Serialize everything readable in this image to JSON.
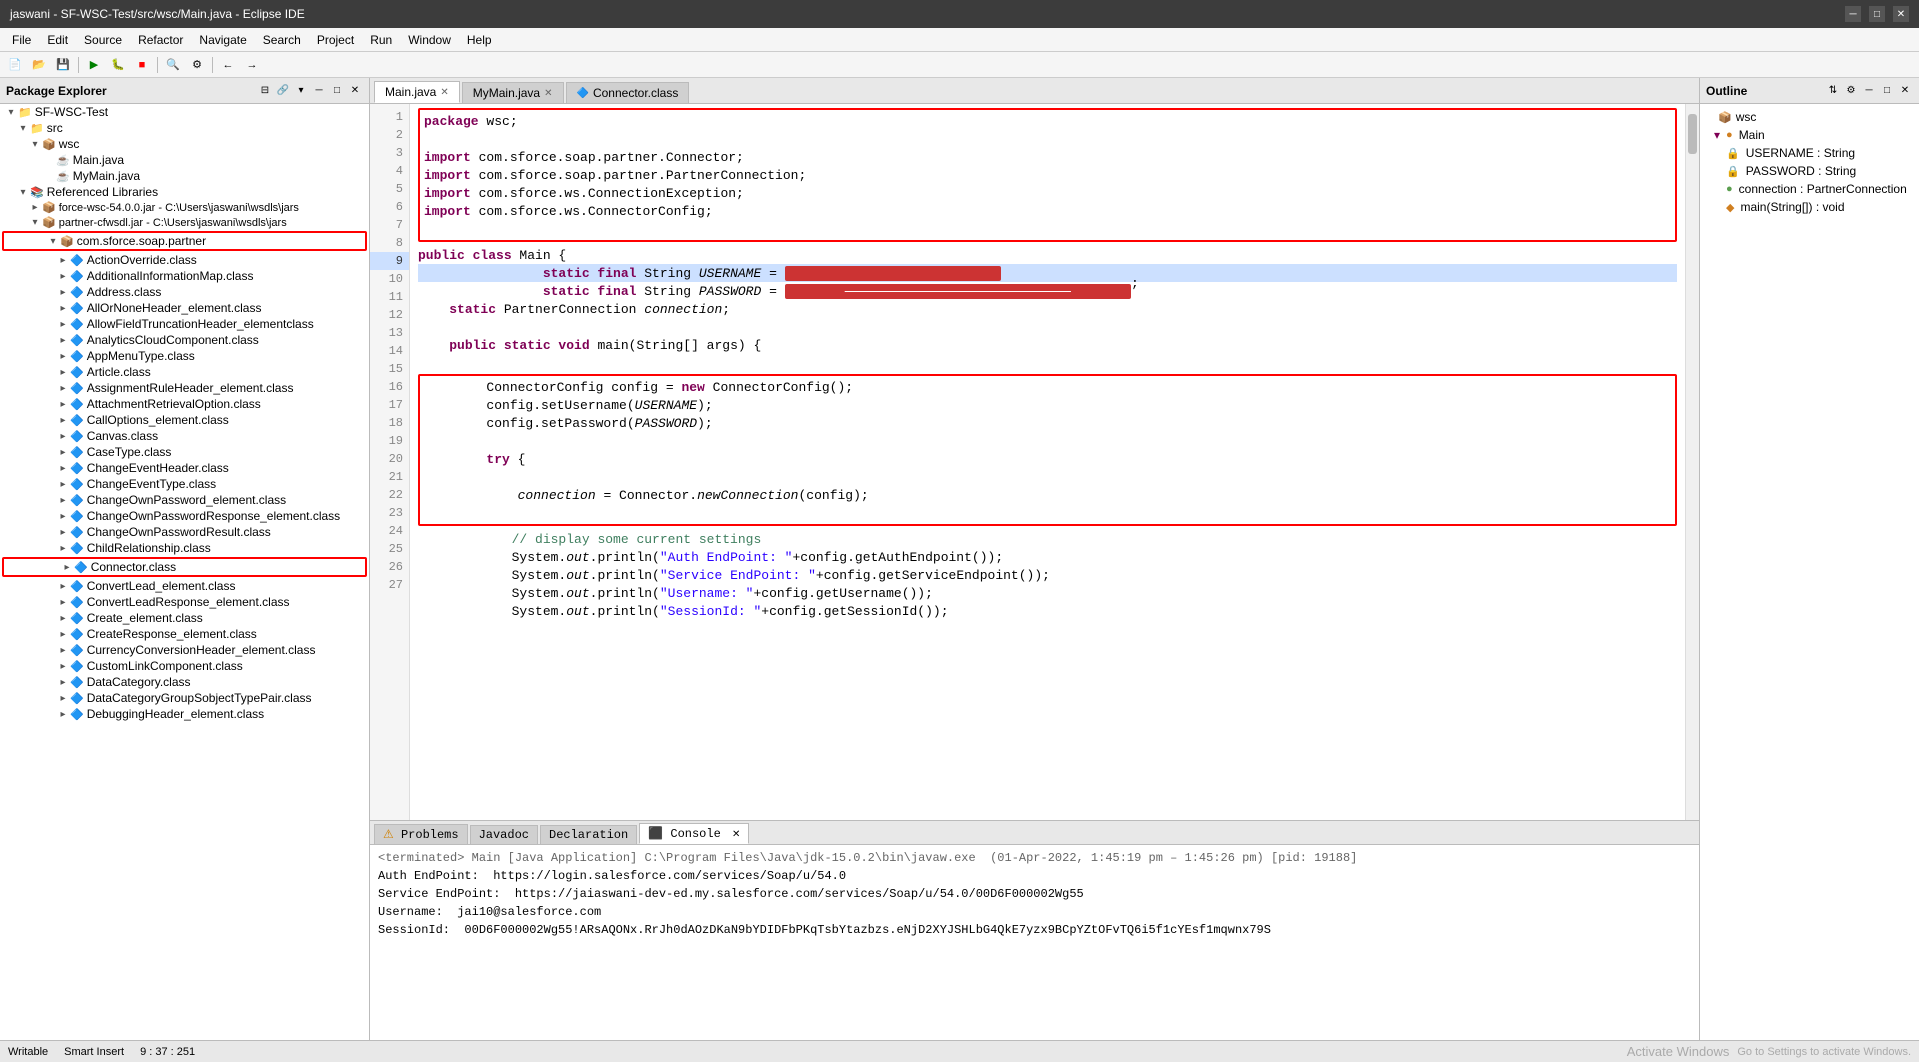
{
  "titleBar": {
    "title": "jaswani - SF-WSC-Test/src/wsc/Main.java - Eclipse IDE",
    "controls": [
      "─",
      "□",
      "✕"
    ]
  },
  "menuBar": {
    "items": [
      "File",
      "Edit",
      "Source",
      "Refactor",
      "Navigate",
      "Search",
      "Project",
      "Run",
      "Window",
      "Help"
    ]
  },
  "packageExplorer": {
    "title": "Package Explorer",
    "tree": [
      {
        "id": "sf-wsc-test",
        "label": "SF-WSC-Test",
        "level": 0,
        "type": "project",
        "expanded": true
      },
      {
        "id": "src",
        "label": "src",
        "level": 1,
        "type": "folder",
        "expanded": true
      },
      {
        "id": "wsc",
        "label": "wsc",
        "level": 2,
        "type": "package",
        "expanded": true
      },
      {
        "id": "main-java",
        "label": "Main.java",
        "level": 3,
        "type": "java"
      },
      {
        "id": "mymain-java",
        "label": "MyMain.java",
        "level": 3,
        "type": "java"
      },
      {
        "id": "ref-libs",
        "label": "Referenced Libraries",
        "level": 1,
        "type": "reflibs",
        "expanded": true
      },
      {
        "id": "force-wsc",
        "label": "force-wsc-54.0.0.jar - C:\\Users\\jaswani\\wsdls\\jars",
        "level": 2,
        "type": "jar"
      },
      {
        "id": "partner-cfwsdl",
        "label": "partner-cfwsdl.jar - C:\\Users\\jaswani\\wsdls\\jars",
        "level": 2,
        "type": "jar",
        "expanded": true
      },
      {
        "id": "com-sforce-soap-partner",
        "label": "com.sforce.soap.partner",
        "level": 3,
        "type": "package",
        "expanded": true,
        "boxed": true
      },
      {
        "id": "actionoverride",
        "label": "ActionOverride.class",
        "level": 4,
        "type": "class"
      },
      {
        "id": "additionalinfo",
        "label": "AdditionalInformationMap.class",
        "level": 4,
        "type": "class"
      },
      {
        "id": "address",
        "label": "Address.class",
        "level": 4,
        "type": "class"
      },
      {
        "id": "allornone",
        "label": "AllOrNoneHeader_element.class",
        "level": 4,
        "type": "class"
      },
      {
        "id": "allowfield",
        "label": "AllowFieldTruncationHeader_elementclass",
        "level": 4,
        "type": "class"
      },
      {
        "id": "analytics",
        "label": "AnalyticsCloudComponent.class",
        "level": 4,
        "type": "class"
      },
      {
        "id": "appmenu",
        "label": "AppMenuType.class",
        "level": 4,
        "type": "class"
      },
      {
        "id": "article",
        "label": "Article.class",
        "level": 4,
        "type": "class"
      },
      {
        "id": "assignmentrule",
        "label": "AssignmentRuleHeader_element.class",
        "level": 4,
        "type": "class"
      },
      {
        "id": "attachmentret",
        "label": "AttachmentRetrievalOption.class",
        "level": 4,
        "type": "class"
      },
      {
        "id": "calloptions",
        "label": "CallOptions_element.class",
        "level": 4,
        "type": "class"
      },
      {
        "id": "canvas",
        "label": "Canvas.class",
        "level": 4,
        "type": "class"
      },
      {
        "id": "casetype",
        "label": "CaseType.class",
        "level": 4,
        "type": "class"
      },
      {
        "id": "changeeventheader",
        "label": "ChangeEventHeader.class",
        "level": 4,
        "type": "class"
      },
      {
        "id": "changeeventtype",
        "label": "ChangeEventType.class",
        "level": 4,
        "type": "class"
      },
      {
        "id": "changeownpassword",
        "label": "ChangeOwnPassword_element.class",
        "level": 4,
        "type": "class"
      },
      {
        "id": "changeownpasswordresp",
        "label": "ChangeOwnPasswordResponse_element.class",
        "level": 4,
        "type": "class"
      },
      {
        "id": "changeownpasswordresult",
        "label": "ChangeOwnPasswordResult.class",
        "level": 4,
        "type": "class"
      },
      {
        "id": "childrelationship",
        "label": "ChildRelationship.class",
        "level": 4,
        "type": "class"
      },
      {
        "id": "connector-class",
        "label": "Connector.class",
        "level": 4,
        "type": "class",
        "boxed": true
      },
      {
        "id": "convertlead",
        "label": "ConvertLead_element.class",
        "level": 4,
        "type": "class"
      },
      {
        "id": "convertleadresp",
        "label": "ConvertLeadResponse_element.class",
        "level": 4,
        "type": "class"
      },
      {
        "id": "create",
        "label": "Create_element.class",
        "level": 4,
        "type": "class"
      },
      {
        "id": "createresp",
        "label": "CreateResponse_element.class",
        "level": 4,
        "type": "class"
      },
      {
        "id": "currencyconv",
        "label": "CurrencyConversionHeader_element.class",
        "level": 4,
        "type": "class"
      },
      {
        "id": "customlink",
        "label": "CustomLinkComponent.class",
        "level": 4,
        "type": "class"
      },
      {
        "id": "datacategory",
        "label": "DataCategory.class",
        "level": 4,
        "type": "class"
      },
      {
        "id": "datacategorygroup",
        "label": "DataCategoryGroupSobjectTypePair.class",
        "level": 4,
        "type": "class"
      },
      {
        "id": "debuggingheader",
        "label": "DebuggingHeader_element.class",
        "level": 4,
        "type": "class"
      }
    ]
  },
  "editorTabs": [
    {
      "id": "main-java-tab",
      "label": "Main.java",
      "active": true,
      "modified": false
    },
    {
      "id": "mymain-java-tab",
      "label": "MyMain.java",
      "active": false,
      "modified": false
    },
    {
      "id": "connector-class-tab",
      "label": "Connector.class",
      "active": false,
      "modified": false
    }
  ],
  "codeEditor": {
    "lines": [
      {
        "num": 1,
        "text": "package wsc;",
        "highlighted": false
      },
      {
        "num": 2,
        "text": "",
        "highlighted": false
      },
      {
        "num": 3,
        "text": "import com.sforce.soap.partner.Connector;",
        "highlighted": false
      },
      {
        "num": 4,
        "text": "import com.sforce.soap.partner.PartnerConnection;",
        "highlighted": false
      },
      {
        "num": 5,
        "text": "import com.sforce.ws.ConnectionException;",
        "highlighted": false
      },
      {
        "num": 6,
        "text": "import com.sforce.ws.ConnectorConfig;",
        "highlighted": false
      },
      {
        "num": 7,
        "text": "",
        "highlighted": false
      },
      {
        "num": 8,
        "text": "public class Main {",
        "highlighted": false
      },
      {
        "num": 9,
        "text": "    static final String USERNAME = ██████████████████",
        "highlighted": true
      },
      {
        "num": 10,
        "text": "    static final String PASSWORD = ████████████████████████████;",
        "highlighted": false
      },
      {
        "num": 11,
        "text": "    static PartnerConnection connection;",
        "highlighted": false
      },
      {
        "num": 12,
        "text": "",
        "highlighted": false
      },
      {
        "num": 13,
        "text": "    public static void main(String[] args) {",
        "highlighted": false
      },
      {
        "num": 14,
        "text": "",
        "highlighted": false
      },
      {
        "num": 15,
        "text": "        ConnectorConfig config = new ConnectorConfig();",
        "highlighted": false
      },
      {
        "num": 16,
        "text": "        config.setUsername(USERNAME);",
        "highlighted": false
      },
      {
        "num": 17,
        "text": "        config.setPassword(PASSWORD);",
        "highlighted": false
      },
      {
        "num": 18,
        "text": "",
        "highlighted": false
      },
      {
        "num": 19,
        "text": "        try {",
        "highlighted": false
      },
      {
        "num": 20,
        "text": "",
        "highlighted": false
      },
      {
        "num": 21,
        "text": "            connection = Connector.newConnection(config);",
        "highlighted": false
      },
      {
        "num": 22,
        "text": "",
        "highlighted": false
      },
      {
        "num": 23,
        "text": "            // display some current settings",
        "highlighted": false
      },
      {
        "num": 24,
        "text": "            System.out.println(\"Auth EndPoint: \"+config.getAuthEndpoint());",
        "highlighted": false
      },
      {
        "num": 25,
        "text": "            System.out.println(\"Service EndPoint: \"+config.getServiceEndpoint());",
        "highlighted": false
      },
      {
        "num": 26,
        "text": "            System.out.println(\"Username: \"+config.getUsername());",
        "highlighted": false
      },
      {
        "num": 27,
        "text": "            System.out.println(\"SessionId: \"+config.getSessionId());",
        "highlighted": false
      }
    ]
  },
  "bottomPanel": {
    "tabs": [
      "Problems",
      "Javadoc",
      "Declaration",
      "Console"
    ],
    "activeTab": "Console",
    "console": {
      "terminated": "<terminated> Main [Java Application] C:\\Program Files\\Java\\jdk-15.0.2\\bin\\javaw.exe  (01-Apr-2022, 1:45:19 pm – 1:45:26 pm) [pid: 19188]",
      "lines": [
        "Auth EndPoint:  https://login.salesforce.com/services/Soap/u/54.0",
        "Service EndPoint:  https://jaiaswani-dev-ed.my.salesforce.com/services/Soap/u/54.0/00D6F000002Wg55",
        "Username:  jai10@salesforce.com",
        "SessionId:  00D6F000002Wg55!ARsAQONx.RrJh0dAOzDKaN9bYDIDFbPKqTsbYtazbzs.eNjD2XYJSHLbG4QkE7yzx9BCpYZtOFvTQ6i5f1cYEsf1mqwnx79S"
      ]
    }
  },
  "outline": {
    "title": "Outline",
    "items": [
      {
        "id": "outline-wsc",
        "label": "wsc",
        "level": 0,
        "type": "package"
      },
      {
        "id": "outline-main",
        "label": "Main",
        "level": 1,
        "type": "class"
      },
      {
        "id": "outline-username",
        "label": "USERNAME : String",
        "level": 2,
        "type": "field-static"
      },
      {
        "id": "outline-password",
        "label": "PASSWORD : String",
        "level": 2,
        "type": "field-static"
      },
      {
        "id": "outline-connection",
        "label": "connection : PartnerConnection",
        "level": 2,
        "type": "field"
      },
      {
        "id": "outline-main-method",
        "label": "main(String[]) : void",
        "level": 2,
        "type": "method"
      }
    ]
  },
  "statusBar": {
    "writable": "Writable",
    "smartInsert": "Smart Insert",
    "position": "9 : 37 : 251"
  },
  "watermark": {
    "line1": "Activate Windows",
    "line2": "Go to Settings to activate Windows."
  }
}
